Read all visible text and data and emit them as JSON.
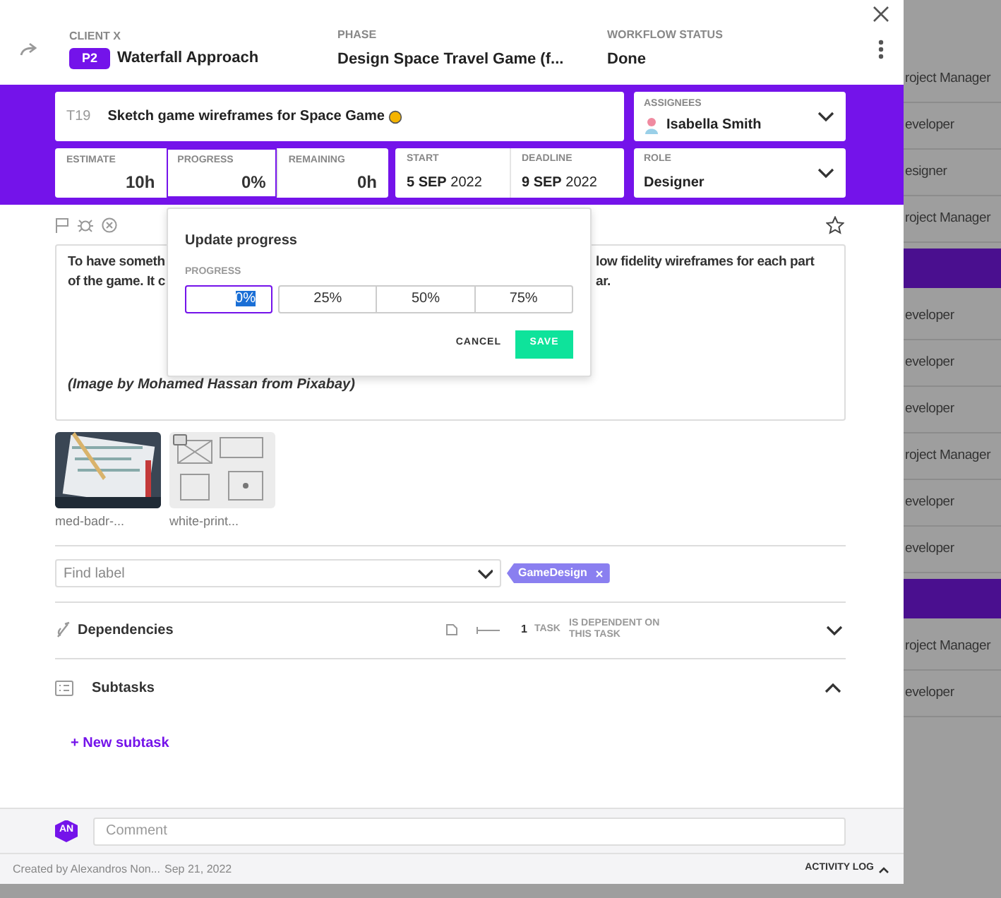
{
  "header": {
    "client_label": "CLIENT X",
    "priority": "P2",
    "project": "Waterfall Approach",
    "phase_label": "PHASE",
    "phase": "Design Space Travel Game (f...",
    "status_label": "WORKFLOW STATUS",
    "status": "Done"
  },
  "task": {
    "id": "T19",
    "title": "Sketch game wireframes for Space Game"
  },
  "assignees": {
    "label": "ASSIGNEES",
    "name": "Isabella Smith"
  },
  "metrics": [
    {
      "label": "ESTIMATE",
      "value": "10h",
      "selected": false
    },
    {
      "label": "PROGRESS",
      "value": "0%",
      "selected": true
    },
    {
      "label": "REMAINING",
      "value": "0h",
      "selected": false
    }
  ],
  "dates": [
    {
      "label": "START",
      "day": "5 SEP",
      "year": "2022"
    },
    {
      "label": "DEADLINE",
      "day": "9 SEP",
      "year": "2022"
    }
  ],
  "role": {
    "label": "ROLE",
    "value": "Designer"
  },
  "description": {
    "lines": [
      {
        "left": "To have someth",
        "right": "low fidelity wireframes for each part"
      },
      {
        "left": "of the game. It c",
        "right": "ar."
      }
    ],
    "credit": "(Image by Mohamed Hassan from Pixabay)"
  },
  "popover": {
    "title": "Update progress",
    "field_label": "PROGRESS",
    "options": [
      {
        "label": "0%",
        "selected": true
      },
      {
        "label": "25%",
        "selected": false
      },
      {
        "label": "50%",
        "selected": false
      },
      {
        "label": "75%",
        "selected": false
      }
    ],
    "cancel": "CANCEL",
    "save": "SAVE"
  },
  "attachments": [
    {
      "name": "med-badr-..."
    },
    {
      "name": "white-print..."
    }
  ],
  "labels": {
    "placeholder": "Find label",
    "tags": [
      "GameDesign"
    ]
  },
  "dependencies": {
    "title": "Dependencies",
    "count": "1",
    "unit": "TASK",
    "relation": "IS DEPENDENT ON THIS TASK",
    "expanded": false
  },
  "subtasks": {
    "title": "Subtasks",
    "expanded": true,
    "new": "+ New subtask"
  },
  "comment": {
    "avatar": "AN",
    "placeholder": "Comment"
  },
  "footer": {
    "created": "Created by Alexandros Non...",
    "date": "Sep 21, 2022",
    "activity": "ACTIVITY LOG"
  },
  "background_rows": [
    {
      "kind": "row",
      "text": "roject Manager"
    },
    {
      "kind": "row",
      "text": "eveloper"
    },
    {
      "kind": "row",
      "text": "esigner"
    },
    {
      "kind": "row",
      "text": "roject Manager"
    },
    {
      "kind": "band"
    },
    {
      "kind": "row",
      "text": "eveloper"
    },
    {
      "kind": "row",
      "text": "eveloper"
    },
    {
      "kind": "row",
      "text": "eveloper"
    },
    {
      "kind": "row",
      "text": "roject Manager"
    },
    {
      "kind": "row",
      "text": "eveloper"
    },
    {
      "kind": "row",
      "text": "eveloper"
    },
    {
      "kind": "band"
    },
    {
      "kind": "row",
      "text": "roject Manager"
    },
    {
      "kind": "row",
      "text": "eveloper"
    }
  ]
}
